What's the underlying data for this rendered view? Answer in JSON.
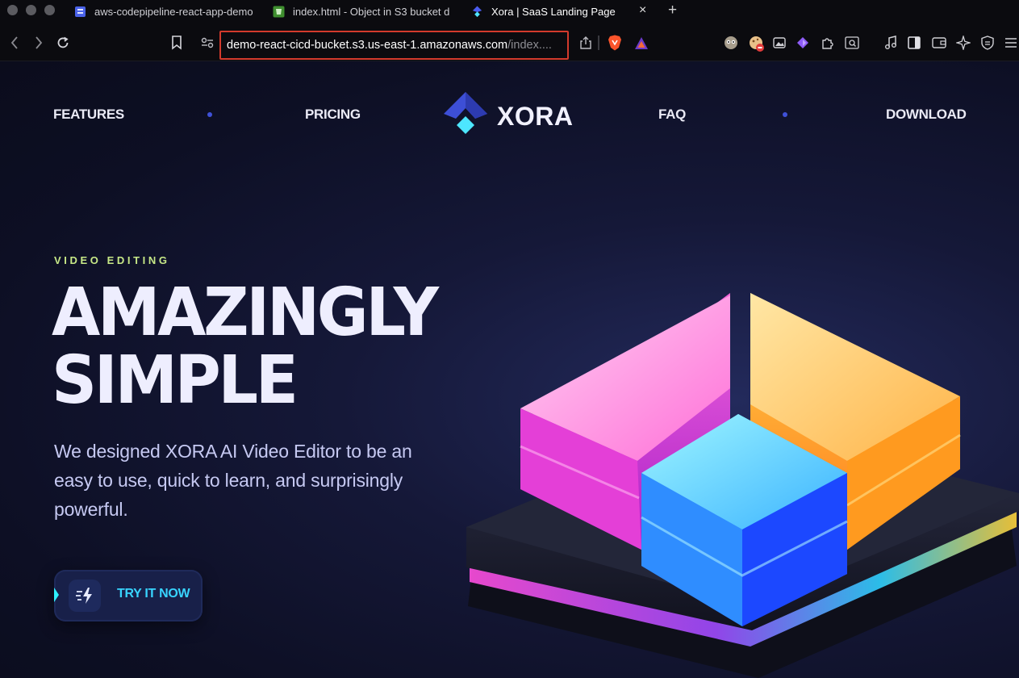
{
  "browser": {
    "tabs": [
      {
        "title": "aws-codepipeline-react-app-demo",
        "icon": "pipeline-icon",
        "active": false
      },
      {
        "title": "index.html - Object in S3 bucket d",
        "icon": "s3-icon",
        "active": false
      },
      {
        "title": "Xora | SaaS Landing Page",
        "icon": "xora-icon",
        "active": true
      }
    ],
    "new_tab_label": "+",
    "close_label": "×",
    "url": {
      "host": "demo-react-cicd-bucket.s3.us-east-1.amazonaws.com",
      "path": "/index...."
    },
    "highlight_color": "#d33a2c"
  },
  "site": {
    "nav": {
      "left": [
        "FEATURES",
        "PRICING"
      ],
      "right": [
        "FAQ",
        "DOWNLOAD"
      ],
      "logo_text": "XORA"
    },
    "hero": {
      "eyebrow": "VIDEO EDITING",
      "title_line1": "AMAZINGLY",
      "title_line2": "SIMPLE",
      "body": "We designed XORA AI Video Editor to be an easy to use, quick to learn, and surprisingly powerful.",
      "cta_label": "TRY IT NOW",
      "cta_icon": "zap-icon"
    },
    "colors": {
      "accent": "#3f51d8",
      "eyebrow": "#c7e887",
      "cta_text": "#38d4ff",
      "background": "#151838"
    }
  }
}
